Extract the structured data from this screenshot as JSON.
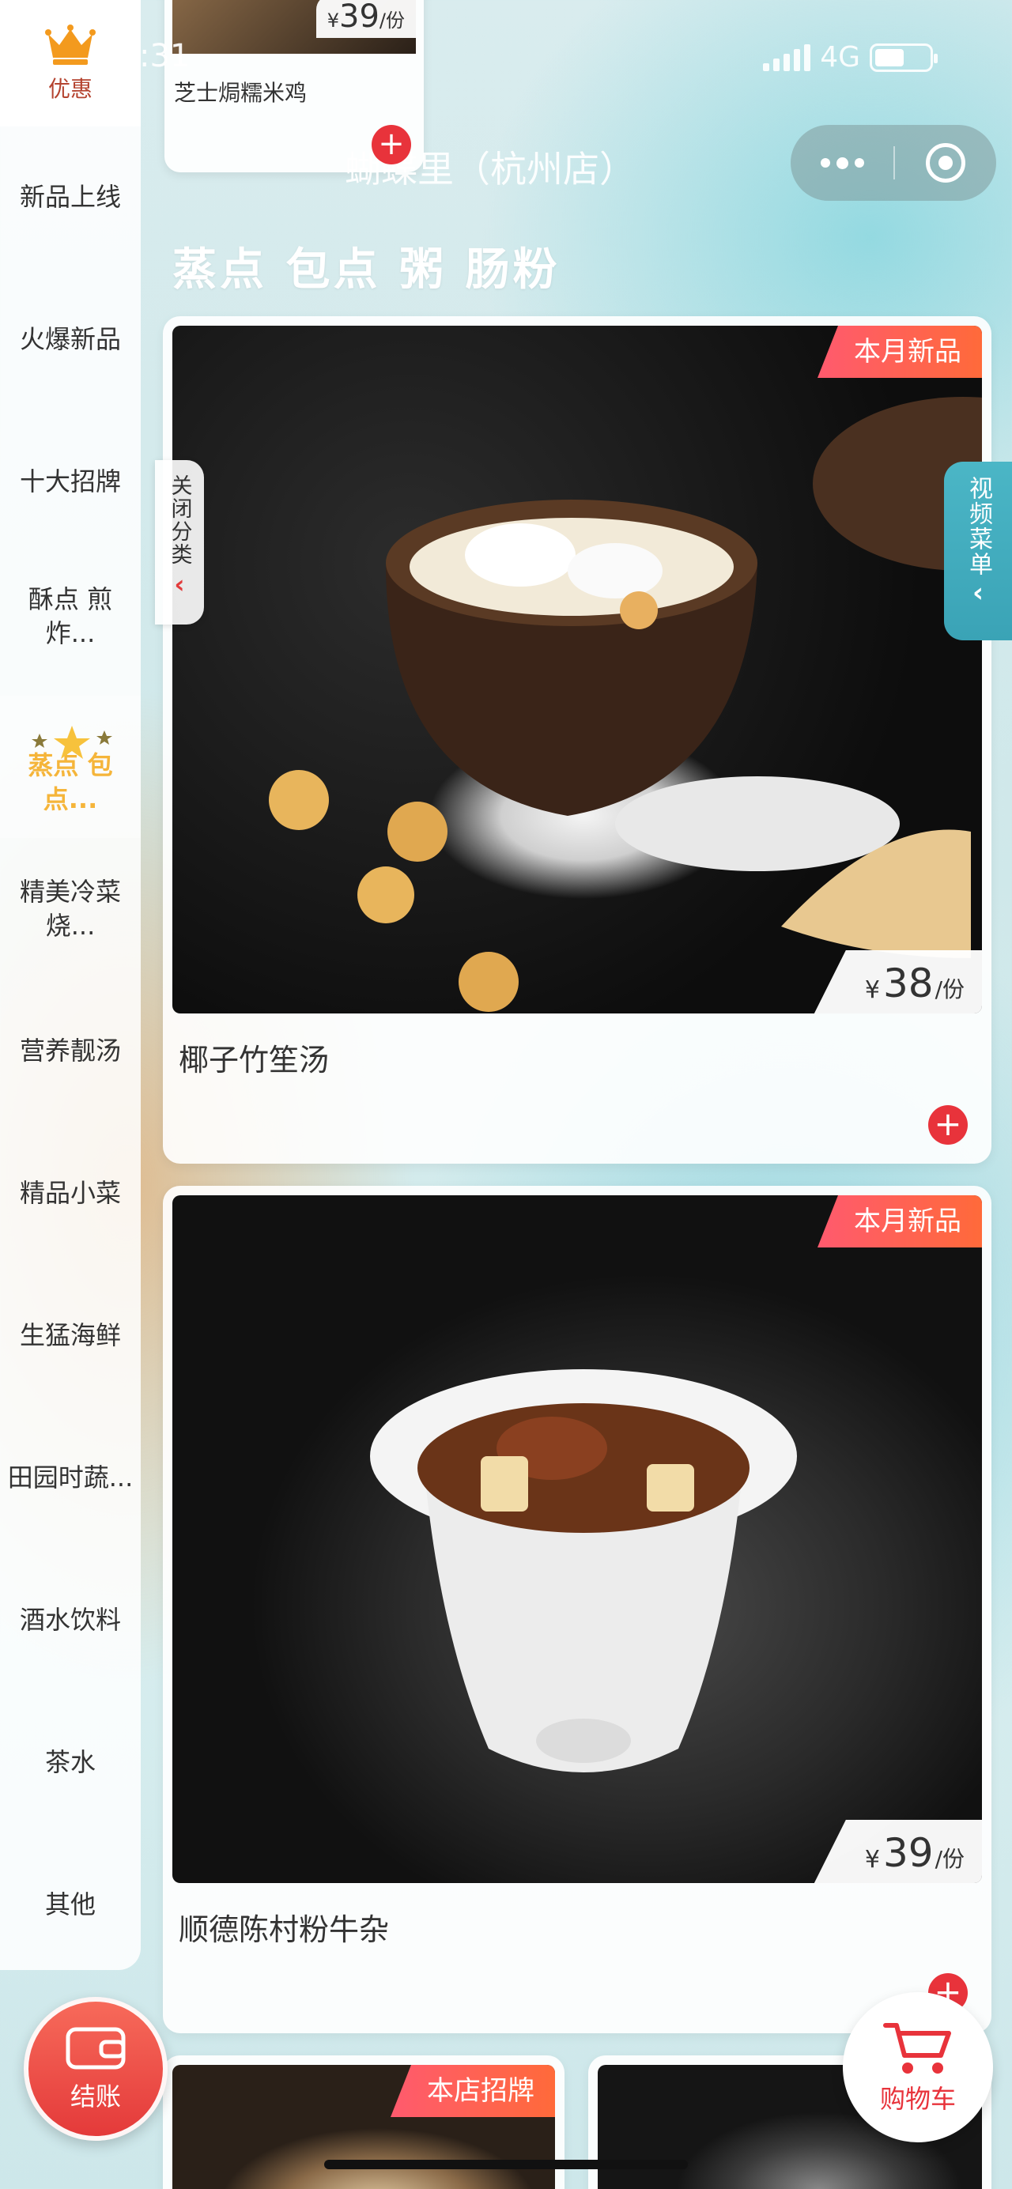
{
  "status_bar": {
    "time": ":31",
    "network": "4G"
  },
  "nav": {
    "store_name": "蝴蝶里（杭州店）"
  },
  "sidebar": {
    "promo_label": "优惠",
    "categories": [
      {
        "label": "新品上线"
      },
      {
        "label": "火爆新品"
      },
      {
        "label": "十大招牌"
      },
      {
        "label": "酥点 煎炸..."
      },
      {
        "label": "蒸点 包点..."
      },
      {
        "label": "精美冷菜烧..."
      },
      {
        "label": "营养靓汤"
      },
      {
        "label": "精品小菜"
      },
      {
        "label": "生猛海鲜"
      },
      {
        "label": "田园时蔬..."
      },
      {
        "label": "酒水饮料"
      },
      {
        "label": "茶水"
      },
      {
        "label": "其他"
      }
    ],
    "active_index": 4,
    "close_tab_label": "关闭分类"
  },
  "video_tab_label": "视频菜单",
  "section_title": "蒸点 包点 粥 肠粉",
  "mini_card": {
    "name": "芝士焗糯米鸡",
    "currency": "¥",
    "price": "39",
    "unit": "/份"
  },
  "products": [
    {
      "name": "椰子竹笙汤",
      "badge": "本月新品",
      "currency": "¥",
      "price": "38",
      "unit": "/份"
    },
    {
      "name": "顺德陈村粉牛杂",
      "badge": "本月新品",
      "currency": "¥",
      "price": "39",
      "unit": "/份"
    },
    {
      "badge": "本店招牌"
    }
  ],
  "buttons": {
    "checkout": "结账",
    "cart": "购物车",
    "add_symbol": "+"
  },
  "colors": {
    "accent_red": "#e8333b",
    "active_gold": "#f5b53a",
    "badge_gradient_start": "#ff5a6e",
    "badge_gradient_end": "#ff6a3a",
    "video_tab": "#3aa3b6"
  }
}
